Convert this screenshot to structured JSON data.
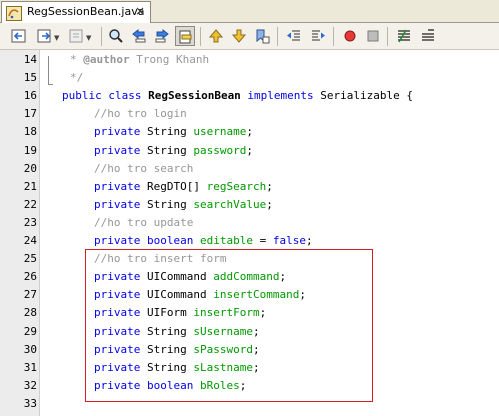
{
  "tab": {
    "title": "RegSessionBean.java",
    "close": "×"
  },
  "toolbar": {
    "buttons": [
      "back-icon",
      "forward-icon",
      "history-icon",
      "find-icon",
      "find-previous-icon",
      "find-next-icon",
      "find-selection-icon",
      "previous-bookmark-icon",
      "next-bookmark-icon",
      "toggle-bookmark-icon",
      "shift-left-icon",
      "shift-right-icon",
      "record-macro-icon",
      "stop-macro-icon",
      "comment-icon",
      "uncomment-icon"
    ]
  },
  "editor": {
    "lines": [
      {
        "n": "14",
        "t": [
          [
            "cmt",
            "* "
          ],
          [
            "tag",
            "@author"
          ],
          [
            "cmt",
            " Trong Khanh"
          ]
        ]
      },
      {
        "n": "15",
        "t": [
          [
            "cmt",
            "*/"
          ]
        ]
      },
      {
        "n": "16",
        "t": [
          [
            "kw",
            "public class "
          ],
          [
            "bold",
            "RegSessionBean"
          ],
          [
            "kw",
            " implements "
          ],
          [
            "",
            "Serializable {"
          ]
        ]
      },
      {
        "n": "17",
        "t": [
          [
            "cmt",
            "//ho tro login"
          ]
        ]
      },
      {
        "n": "18",
        "t": [
          [
            "kw",
            "private "
          ],
          [
            "",
            "String "
          ],
          [
            "field",
            "username"
          ],
          [
            "",
            ";"
          ]
        ]
      },
      {
        "n": "19",
        "t": [
          [
            "kw",
            "private "
          ],
          [
            "",
            "String "
          ],
          [
            "field",
            "password"
          ],
          [
            "",
            ";"
          ]
        ]
      },
      {
        "n": "20",
        "t": [
          [
            "cmt",
            "//ho tro search"
          ]
        ]
      },
      {
        "n": "21",
        "t": [
          [
            "kw",
            "private "
          ],
          [
            "",
            "RegDTO[] "
          ],
          [
            "field",
            "regSearch"
          ],
          [
            "",
            ";"
          ]
        ]
      },
      {
        "n": "22",
        "t": [
          [
            "kw",
            "private "
          ],
          [
            "",
            "String "
          ],
          [
            "field",
            "searchValue"
          ],
          [
            "",
            ";"
          ]
        ]
      },
      {
        "n": "23",
        "t": [
          [
            "cmt",
            "//ho tro update"
          ]
        ]
      },
      {
        "n": "24",
        "t": [
          [
            "kw",
            "private boolean "
          ],
          [
            "field",
            "editable"
          ],
          [
            "",
            " = "
          ],
          [
            "kw",
            "false"
          ],
          [
            "",
            ";"
          ]
        ]
      },
      {
        "n": "25",
        "t": [
          [
            "cmt",
            "//ho tro insert form"
          ]
        ]
      },
      {
        "n": "26",
        "t": [
          [
            "kw",
            "private "
          ],
          [
            "",
            "UICommand "
          ],
          [
            "field",
            "addCommand"
          ],
          [
            "",
            ";"
          ]
        ]
      },
      {
        "n": "27",
        "t": [
          [
            "kw",
            "private "
          ],
          [
            "",
            "UICommand "
          ],
          [
            "field",
            "insertCommand"
          ],
          [
            "",
            ";"
          ]
        ]
      },
      {
        "n": "28",
        "t": [
          [
            "kw",
            "private "
          ],
          [
            "",
            "UIForm "
          ],
          [
            "field",
            "insertForm"
          ],
          [
            "",
            ";"
          ]
        ]
      },
      {
        "n": "29",
        "t": [
          [
            "kw",
            "private "
          ],
          [
            "",
            "String "
          ],
          [
            "field",
            "sUsername"
          ],
          [
            "",
            ";"
          ]
        ]
      },
      {
        "n": "30",
        "t": [
          [
            "kw",
            "private "
          ],
          [
            "",
            "String "
          ],
          [
            "field",
            "sPassword"
          ],
          [
            "",
            ";"
          ]
        ]
      },
      {
        "n": "31",
        "t": [
          [
            "kw",
            "private "
          ],
          [
            "",
            "String "
          ],
          [
            "field",
            "sLastname"
          ],
          [
            "",
            ";"
          ]
        ]
      },
      {
        "n": "32",
        "t": [
          [
            "kw",
            "private boolean "
          ],
          [
            "field",
            "bRoles"
          ],
          [
            "",
            ";"
          ]
        ]
      },
      {
        "n": "33",
        "t": []
      }
    ]
  }
}
